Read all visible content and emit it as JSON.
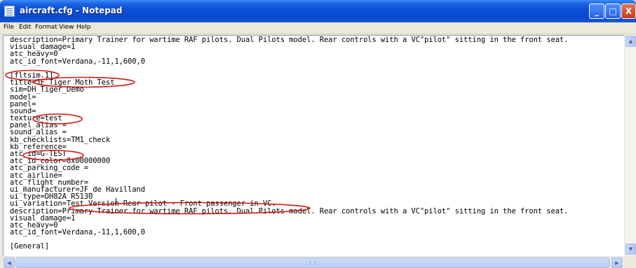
{
  "window": {
    "title": "aircraft.cfg - Notepad",
    "icon": "notepad-icon",
    "controls": {
      "minimize": "_",
      "maximize": "□",
      "close": "X"
    }
  },
  "menu": {
    "items": [
      "File",
      "Edit",
      "Format",
      "View",
      "Help"
    ]
  },
  "editor": {
    "lines": [
      "description=Primary Trainer for wartime RAF pilots. Dual Pilots model. Rear controls with a VC\"pilot\" sitting in the front seat.",
      "visual_damage=1",
      "atc_heavy=0",
      "atc_id_font=Verdana,-11,1,600,0",
      "",
      "[fltsim.1]",
      "title=JF Tiger Moth Test",
      "sim=DH_Tiger_Demo",
      "model=",
      "panel=",
      "sound=",
      "texture=test",
      "panel_alias =",
      "sound_alias =",
      "kb_checklists=TM1_check",
      "kb_reference=",
      "atc_id=G-TEST",
      "atc_id_color=0x00000000",
      "atc_parking_code =",
      "atc_airline=",
      "atc_flight_number=",
      "ui_manufacturer=JF_de Havilland",
      "ui_type=DH82A_R5130",
      "ui_variation=Test Version Rear pilot - Front passenger in VC.",
      "description=Primary Trainer for wartime RAF pilots. Dual Pilots model. Rear controls with a VC\"pilot\" sitting in the front seat.",
      "visual_damage=1",
      "atc_heavy=0",
      "atc_id_font=Verdana,-11,1,600,0",
      "",
      "[General]"
    ]
  },
  "annotation_color": "#d01818",
  "scrollbars": {
    "up_arrow": "▲",
    "down_arrow": "▼",
    "left_arrow": "◀",
    "right_arrow": "▶"
  }
}
